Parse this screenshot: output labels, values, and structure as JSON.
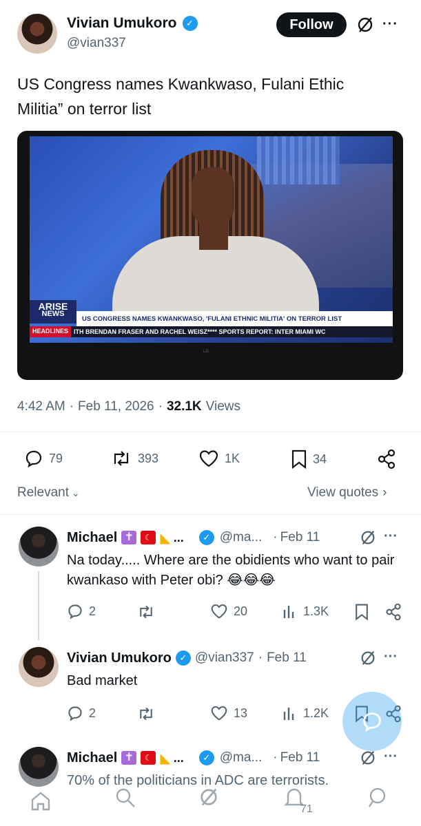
{
  "author": {
    "name": "Vivian Umukoro",
    "handle": "@vian337"
  },
  "header": {
    "follow_label": "Follow",
    "more_label": "···"
  },
  "tweet": {
    "text": "US Congress names Kwankwaso, Fulani Ethic Militia” on terror list",
    "time": "4:42 AM",
    "date": "Feb 11, 2026",
    "views_count": "32.1K",
    "views_label": "Views"
  },
  "media": {
    "logo_top": "ARISE",
    "logo_bottom": "NEWS",
    "ticker_headline": "US CONGRESS NAMES KWANKWASO, 'FULANI ETHNIC MILITIA' ON TERROR LIST",
    "ticker_tag": "HEADLINES",
    "ticker_crawl": "ITH BRENDAN FRASER AND RACHEL WEISZ**** SPORTS REPORT: INTER MIAMI WC",
    "tv_brand": "LG"
  },
  "actions": {
    "replies": "79",
    "reposts": "393",
    "likes": "1K",
    "bookmarks": "34"
  },
  "sort": {
    "label": "Relevant",
    "view_quotes": "View quotes"
  },
  "replies": [
    {
      "name": "Michael",
      "handle": "@ma...",
      "date": "Feb 11",
      "text": "Na today..... Where are the obidients who want to pair kwankaso with Peter obi? 😂😂😂",
      "replies": "2",
      "reposts": "",
      "likes": "20",
      "views": "1.3K"
    },
    {
      "name": "Vivian Umukoro",
      "handle": "@vian337",
      "date": "Feb 11",
      "text": "Bad market",
      "replies": "2",
      "reposts": "",
      "likes": "13",
      "views": "1.2K"
    },
    {
      "name": "Michael",
      "handle": "@ma...",
      "date": "Feb 11",
      "text": "70% of the politicians in ADC are terrorists.",
      "views": "71"
    }
  ],
  "colors": {
    "accent": "#1d9bf0",
    "text": "#0f1419",
    "muted": "#536471"
  }
}
